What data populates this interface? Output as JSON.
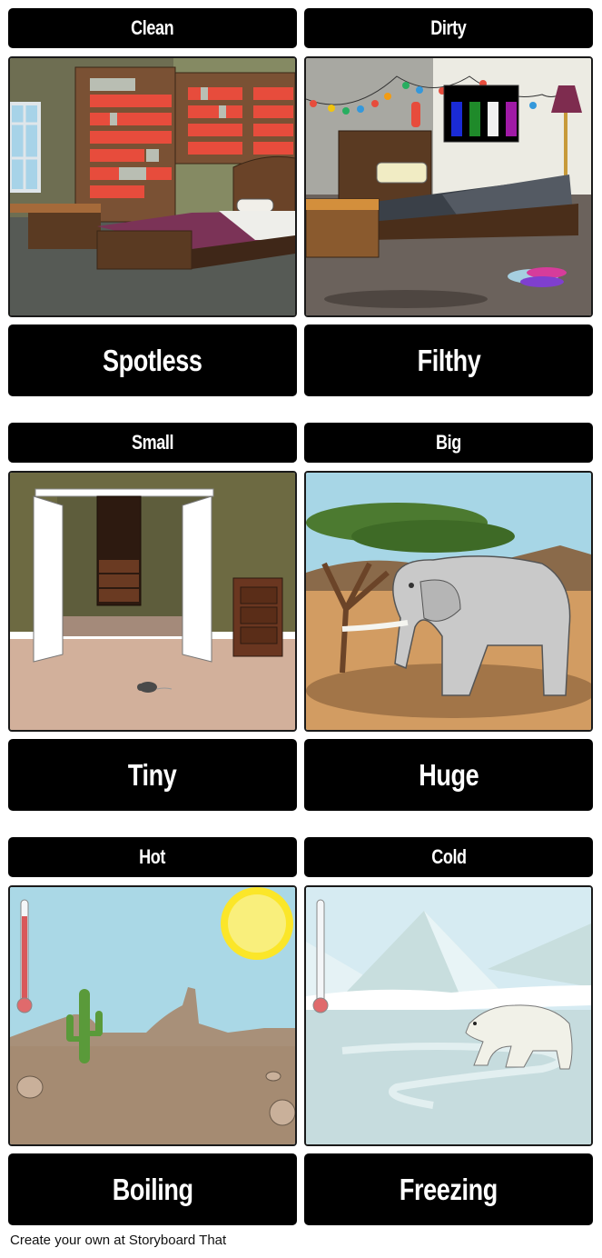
{
  "storyboard": {
    "rows": [
      {
        "cells": [
          {
            "title": "Clean",
            "caption": "Spotless",
            "scene": "tidy-bedroom-with-bookshelves"
          },
          {
            "title": "Dirty",
            "caption": "Filthy",
            "scene": "messy-bedroom-with-clothes"
          }
        ]
      },
      {
        "cells": [
          {
            "title": "Small",
            "caption": "Tiny",
            "scene": "closet-room-with-mouse"
          },
          {
            "title": "Big",
            "caption": "Huge",
            "scene": "savanna-with-elephant"
          }
        ]
      },
      {
        "cells": [
          {
            "title": "Hot",
            "caption": "Boiling",
            "scene": "desert-with-sun-and-cactus"
          },
          {
            "title": "Cold",
            "caption": "Freezing",
            "scene": "arctic-with-polar-bear"
          }
        ]
      }
    ]
  },
  "footer": {
    "text": "Create your own at Storyboard That"
  },
  "colors": {
    "title_bg": "#000000",
    "title_text": "#ffffff",
    "thermometer_hot_level": 0.85,
    "thermometer_cold_level": 0.0
  }
}
